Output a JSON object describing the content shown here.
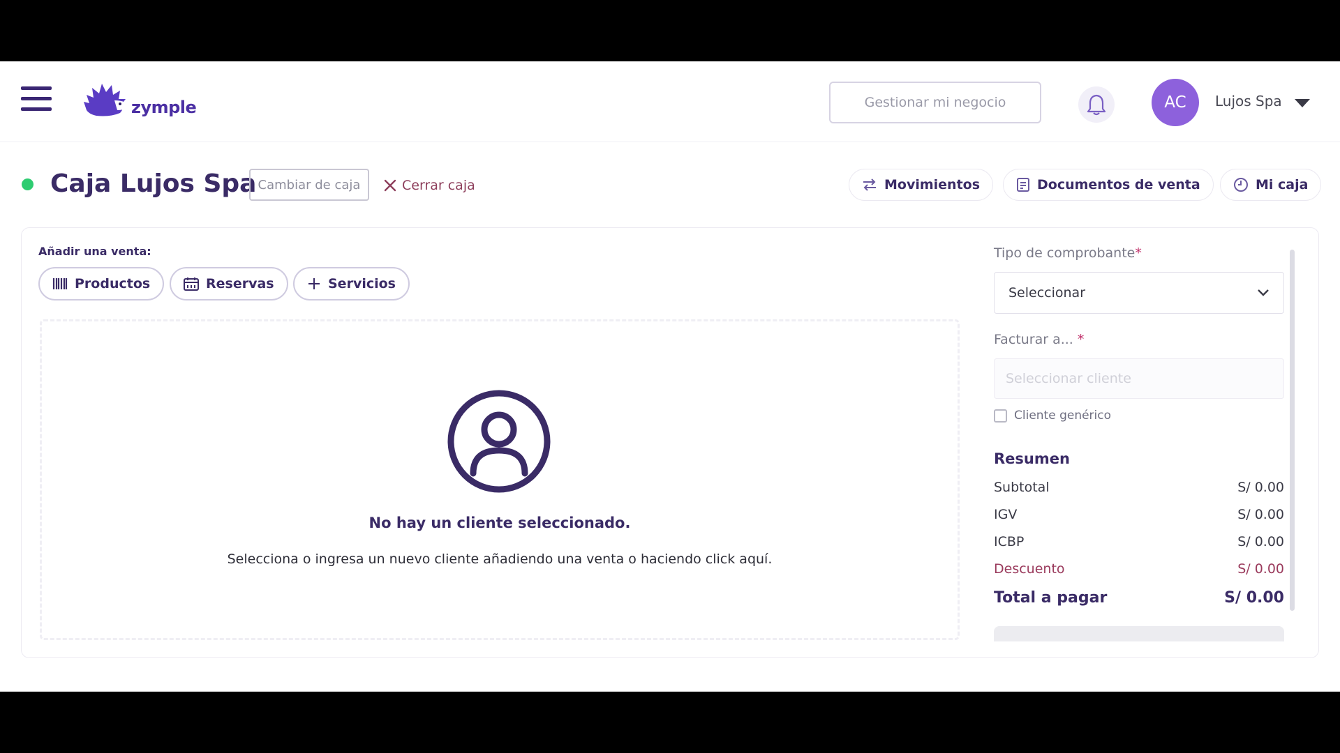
{
  "header": {
    "logo_text": "zymple",
    "manage_button": "Gestionar mi negocio",
    "avatar_initials": "AC",
    "user_name": "Lujos Spa"
  },
  "toolbar": {
    "title": "Caja Lujos Spa",
    "change_box": "Cambiar de caja",
    "close_box": "Cerrar caja",
    "movements": "Movimientos",
    "sales_docs": "Documentos de venta",
    "my_box": "Mi caja"
  },
  "sale": {
    "add_label": "Añadir una venta:",
    "tabs": [
      "Productos",
      "Reservas",
      "Servicios"
    ],
    "empty_title": "No hay un cliente seleccionado.",
    "empty_subtitle": "Selecciona o ingresa un nuevo cliente añadiendo una venta o haciendo click aquí."
  },
  "panel": {
    "voucher_label": "Tipo de comprobante",
    "voucher_value": "Seleccionar",
    "bill_to_label": "Facturar a...",
    "client_placeholder": "Seleccionar cliente",
    "generic_client": "Cliente genérico",
    "summary_title": "Resumen",
    "required_mark": "*",
    "rows": [
      {
        "label": "Subtotal",
        "value": "S/ 0.00"
      },
      {
        "label": "IGV",
        "value": "S/ 0.00"
      },
      {
        "label": "ICBP",
        "value": "S/ 0.00"
      },
      {
        "label": "Descuento",
        "value": "S/ 0.00"
      }
    ],
    "total_label": "Total a pagar",
    "total_value": "S/ 0.00"
  },
  "colors": {
    "brand": "#3a2b66",
    "accent": "#8d61dc",
    "status_open": "#2ecc71",
    "discount": "#9a3a5c"
  }
}
